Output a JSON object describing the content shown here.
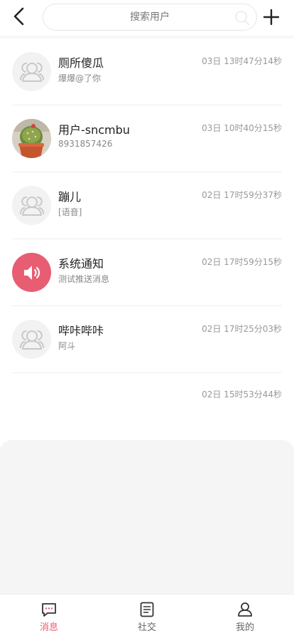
{
  "header": {
    "search_placeholder": "搜索用户",
    "back_icon": "chevron-left-icon",
    "add_icon": "plus-icon",
    "search_icon": "search-icon"
  },
  "conversations": [
    {
      "name": "厕所傻瓜",
      "preview": "爆爆@了你",
      "time": "03日 13时47分14秒",
      "avatar": "default-user-icon"
    },
    {
      "name": "用户-sncmbu",
      "preview": "8931857426",
      "time": "03日 10时40分15秒",
      "avatar": "user-photo"
    },
    {
      "name": "蹦儿",
      "preview": "[语音]",
      "time": "02日 17时59分37秒",
      "avatar": "default-user-icon"
    },
    {
      "name": "系统通知",
      "preview": "测试推送消息",
      "time": "02日 17时59分15秒",
      "avatar": "speaker-icon"
    },
    {
      "name": "哔咔哔咔",
      "preview": "阿斗",
      "time": "02日 17时25分03秒",
      "avatar": "default-user-icon"
    },
    {
      "name": "",
      "preview": "",
      "time": "02日 15时53分44秒",
      "avatar": ""
    }
  ],
  "tabs": [
    {
      "label": "消息",
      "icon": "message-icon",
      "active": true
    },
    {
      "label": "社交",
      "icon": "document-icon",
      "active": false
    },
    {
      "label": "我的",
      "icon": "profile-icon",
      "active": false
    }
  ],
  "colors": {
    "accent": "#e75d72",
    "background": "#ffffff",
    "gray_area": "#f5f5f5"
  }
}
